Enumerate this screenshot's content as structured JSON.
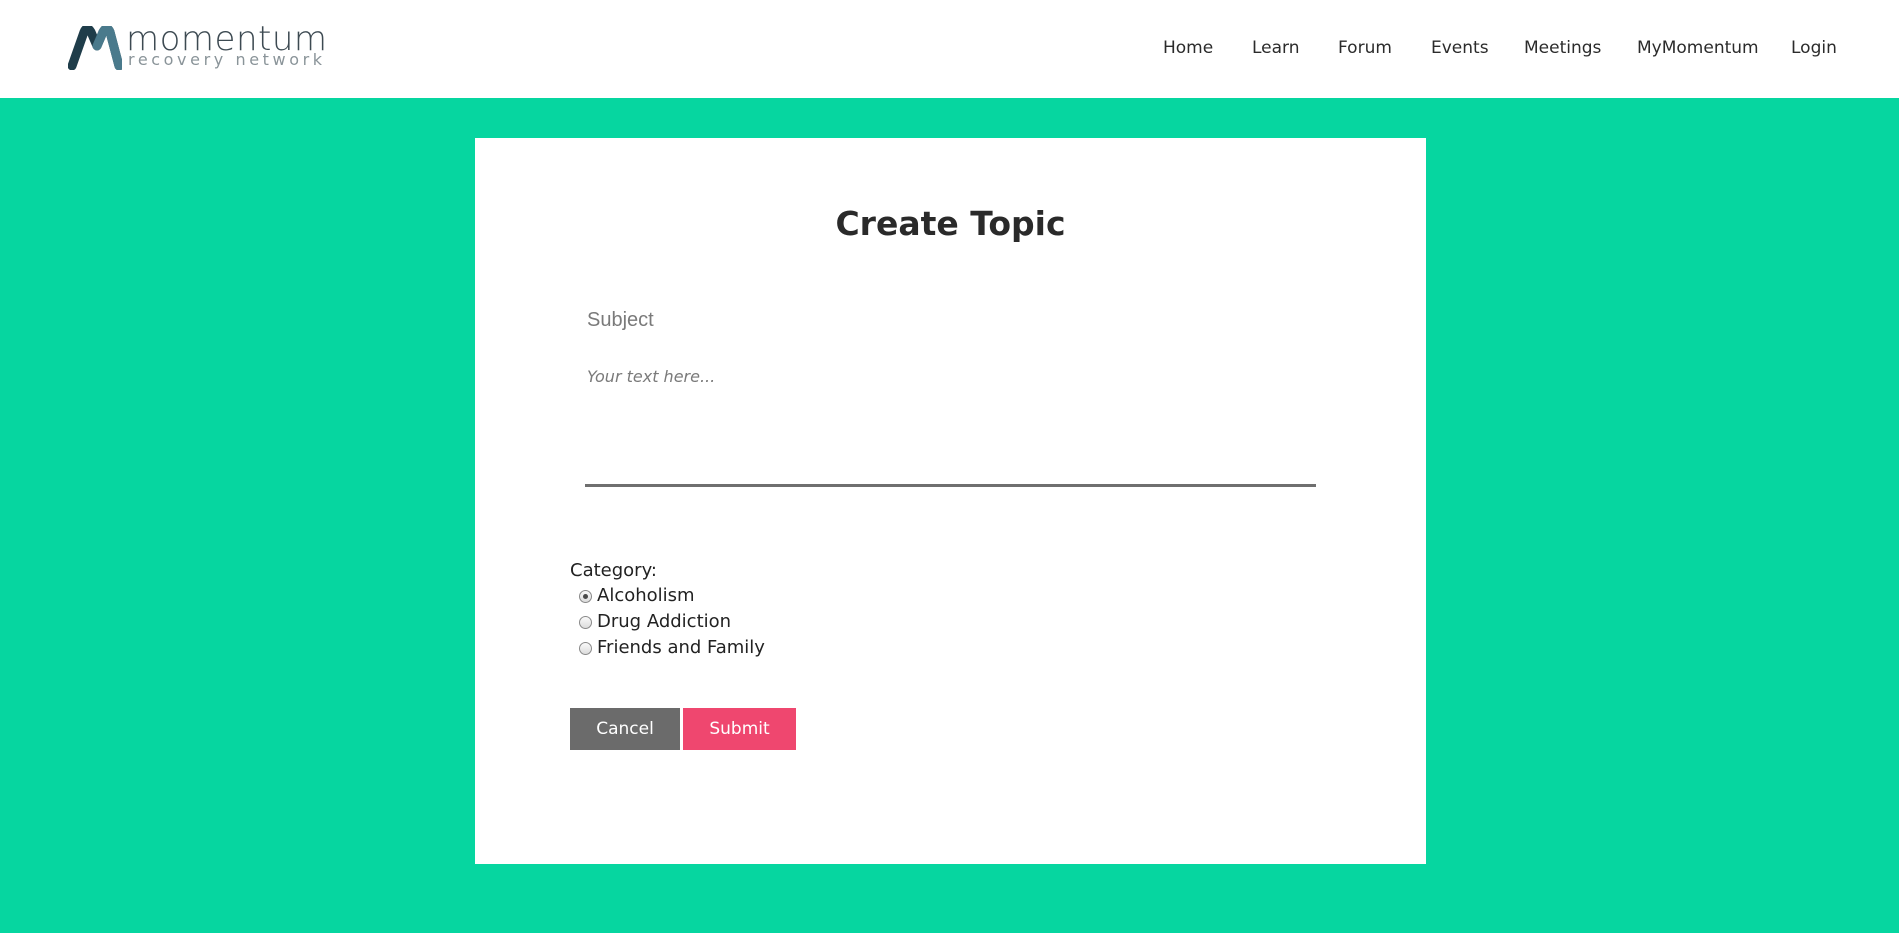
{
  "brand": {
    "name": "momentum",
    "tagline": "recovery network",
    "colors": {
      "mark_dark": "#1f3d4a",
      "mark_light": "#4a7a8c",
      "accent_green": "#06d6a0",
      "submit_pink": "#ef476f",
      "cancel_gray": "#6b6b6b"
    }
  },
  "nav": {
    "items": [
      {
        "label": "Home"
      },
      {
        "label": "Learn"
      },
      {
        "label": "Forum"
      },
      {
        "label": "Events"
      },
      {
        "label": "Meetings"
      },
      {
        "label": "MyMomentum"
      },
      {
        "label": "Login"
      }
    ]
  },
  "form": {
    "title": "Create Topic",
    "subject_placeholder": "Subject",
    "subject_value": "",
    "body_placeholder": "Your text here...",
    "body_value": "",
    "category_label": "Category:",
    "categories": [
      {
        "label": "Alcoholism",
        "checked": true
      },
      {
        "label": "Drug Addiction",
        "checked": false
      },
      {
        "label": "Friends and Family",
        "checked": false
      }
    ],
    "cancel_label": "Cancel",
    "submit_label": "Submit"
  }
}
